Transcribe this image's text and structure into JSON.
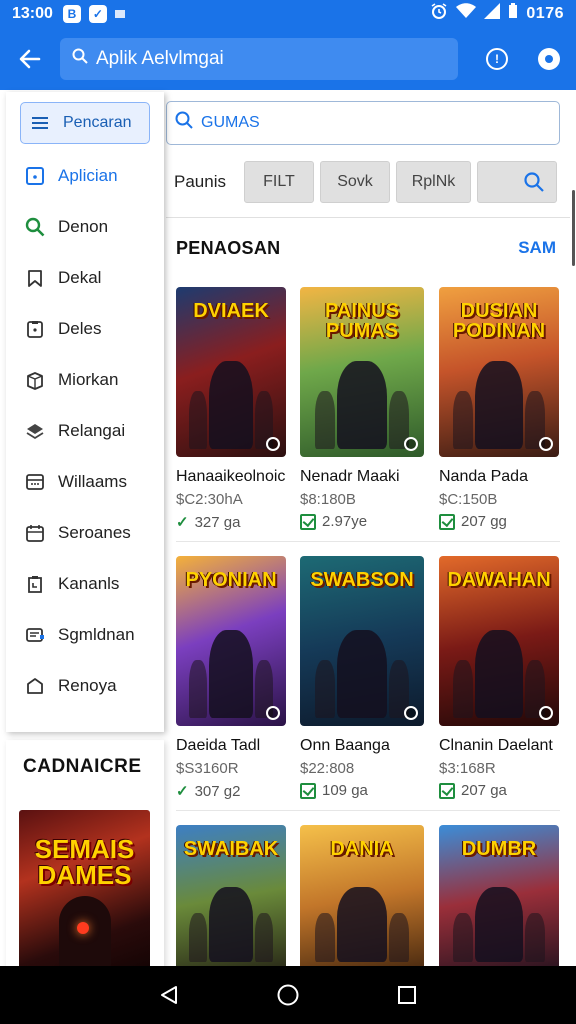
{
  "status_bar": {
    "time": "13:00",
    "app_icon_letter": "B",
    "battery_text": "0176",
    "icons": [
      "b-app-icon",
      "check-app-icon",
      "notification-dash-icon",
      "alarm-icon",
      "wifi-icon",
      "signal-icon"
    ]
  },
  "app_bar": {
    "title": "Aplik Aelvlmgai",
    "back_icon": "arrow-left-icon",
    "info_icon": "info-icon",
    "settings_icon": "gear-icon",
    "accent_color": "#1a73e8"
  },
  "sidebar": {
    "items": [
      {
        "label": "Pencaran",
        "icon": "menu-icon"
      },
      {
        "label": "Aplician",
        "icon": "square-dot-icon"
      },
      {
        "label": "Denon",
        "icon": "search-icon"
      },
      {
        "label": "Dekal",
        "icon": "bookmark-icon"
      },
      {
        "label": "Deles",
        "icon": "clipboard-icon"
      },
      {
        "label": "Miorkan",
        "icon": "cube-icon"
      },
      {
        "label": "Relangai",
        "icon": "stack-icon"
      },
      {
        "label": "Willaams",
        "icon": "calculator-icon"
      },
      {
        "label": "Seroanes",
        "icon": "calendar-icon"
      },
      {
        "label": "Kananls",
        "icon": "clipboard-clock-icon"
      },
      {
        "label": "Sgmldnan",
        "icon": "message-icon"
      },
      {
        "label": "Renoya",
        "icon": "tag-icon"
      }
    ]
  },
  "featured": {
    "title": "CADNAICRE",
    "cover_text": "SEMAIS DAMES"
  },
  "content": {
    "search_value": "GUMAS",
    "filter_label": "Paunis",
    "chips": [
      "FILT",
      "Sovk",
      "RplNk"
    ],
    "section_title": "PENAOSAN",
    "section_link": "SAM"
  },
  "games": [
    {
      "title": "Hanaaikeolnoic",
      "price": "$C2:30hA",
      "meta": "327 ga",
      "cover_text": "DVIAEK",
      "mark": "tick"
    },
    {
      "title": "Nenadr Maaki",
      "price": "$8:180B",
      "meta": "2.97ye",
      "cover_text": "PAINUS PUMAS",
      "mark": "check"
    },
    {
      "title": "Nanda Pada",
      "price": "$C:150B",
      "meta": "207 gg",
      "cover_text": "DUSIAN PODINAN",
      "mark": "check"
    },
    {
      "title": "Daeida Tadl",
      "price": "$S3160R",
      "meta": "307 g2",
      "cover_text": "PYONIAN",
      "mark": "tick"
    },
    {
      "title": "Onn Baanga",
      "price": "$22:808",
      "meta": "109 ga",
      "cover_text": "SWABSON",
      "mark": "check"
    },
    {
      "title": "Clnanin Daelant",
      "price": "$3:168R",
      "meta": "207 ga",
      "cover_text": "DAWAHAN",
      "mark": "check"
    },
    {
      "title": "",
      "price": "",
      "meta": "",
      "cover_text": "SWAIBAK",
      "mark": ""
    },
    {
      "title": "",
      "price": "",
      "meta": "",
      "cover_text": "DANIA",
      "mark": ""
    },
    {
      "title": "",
      "price": "",
      "meta": "",
      "cover_text": "DUMBR",
      "mark": ""
    }
  ],
  "nav_bar": {
    "icons": [
      "back-triangle-icon",
      "home-circle-icon",
      "recents-square-icon"
    ]
  }
}
